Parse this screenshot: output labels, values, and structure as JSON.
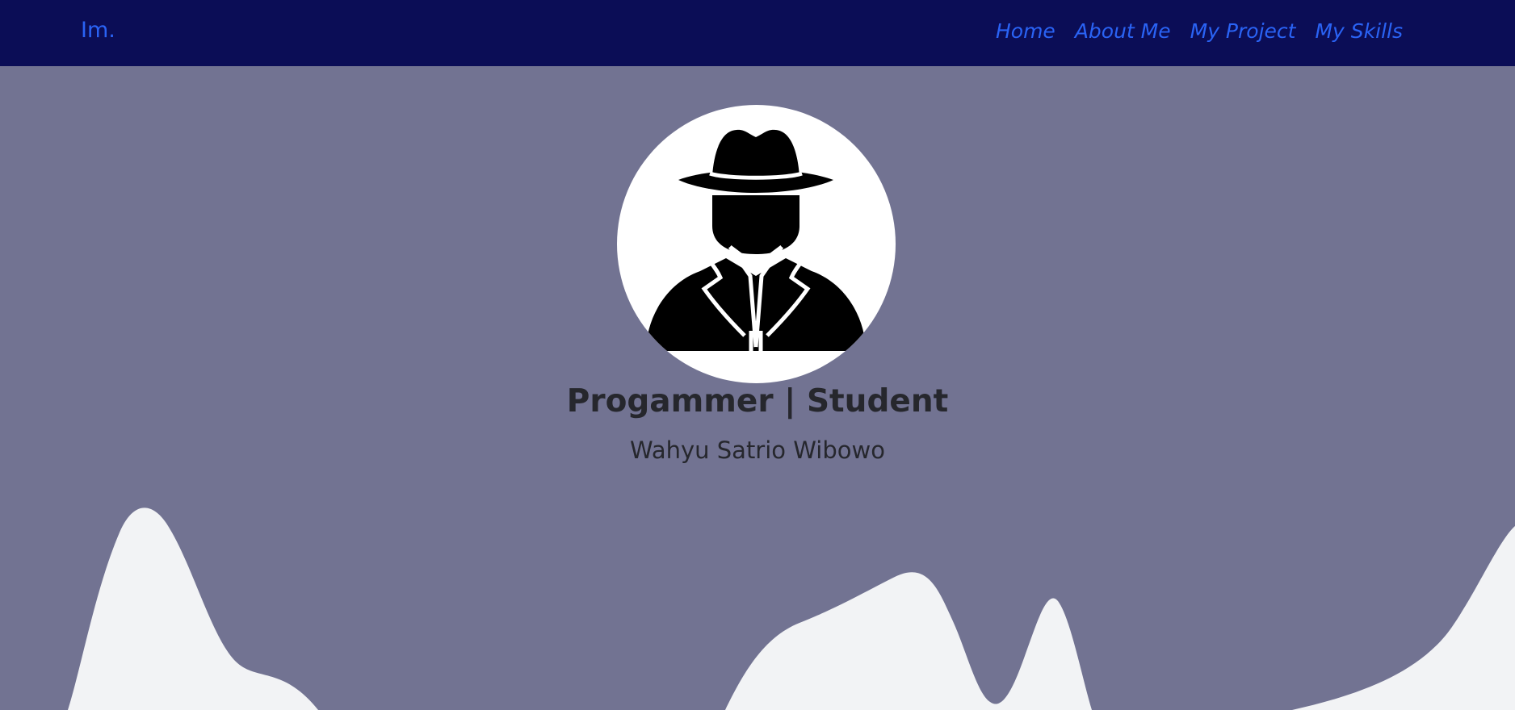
{
  "navbar": {
    "brand": "Im.",
    "links": [
      {
        "label": "Home"
      },
      {
        "label": "About Me"
      },
      {
        "label": "My Project"
      },
      {
        "label": "My Skills"
      }
    ]
  },
  "hero": {
    "avatar_icon": "spy-detective-icon",
    "headline": "Progammer | Student",
    "name": "Wahyu Satrio Wibowo"
  },
  "colors": {
    "navbar_bg": "#0b0d56",
    "link": "#2a63f5",
    "page_bg": "#727392",
    "wave": "#f2f3f5",
    "text": "#26272d"
  }
}
